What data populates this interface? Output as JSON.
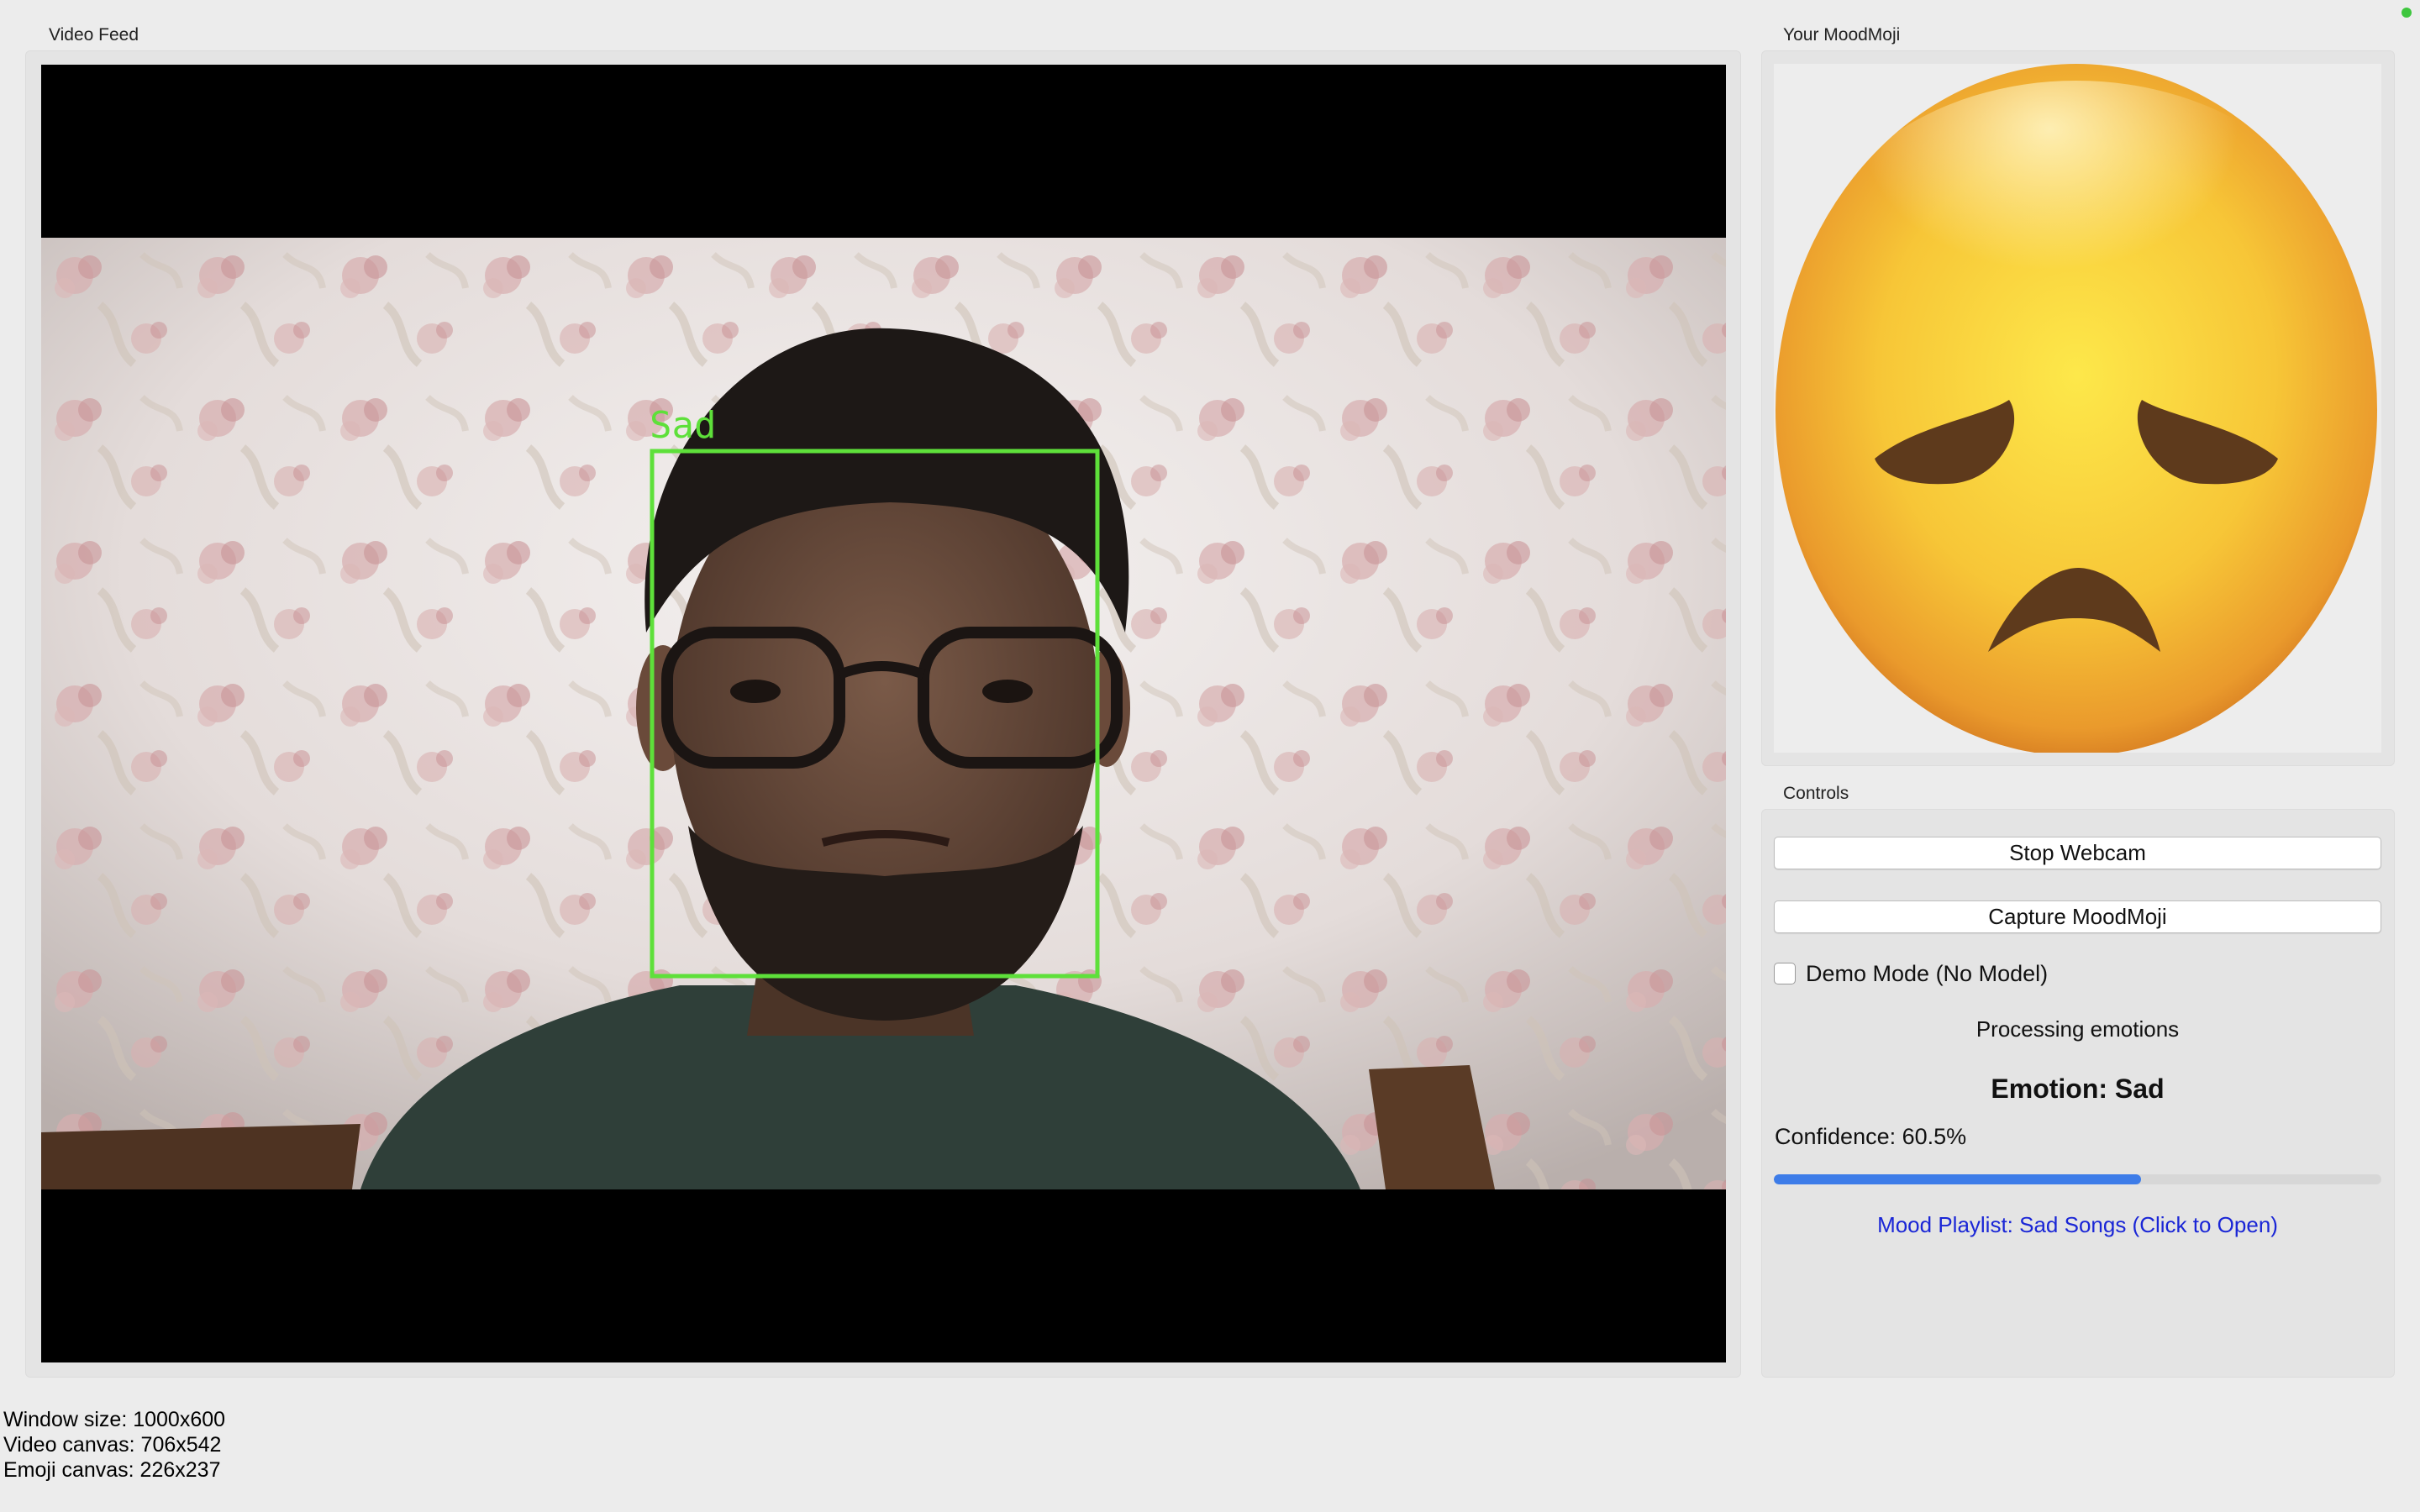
{
  "video": {
    "group_title": "Video Feed",
    "detection_label": "Sad"
  },
  "emoji": {
    "group_title": "Your MoodMoji",
    "emoji_icon": "sad-face-emoji"
  },
  "controls": {
    "group_title": "Controls",
    "stop_button": "Stop Webcam",
    "capture_button": "Capture MoodMoji",
    "demo_mode_label": "Demo Mode (No Model)",
    "demo_mode_checked": false,
    "processing_status": "Processing emotions",
    "emotion": "Emotion: Sad",
    "confidence": "Confidence: 60.5%",
    "confidence_value": 0.605,
    "playlist_link": "Mood Playlist: Sad Songs (Click to Open)"
  },
  "debug": {
    "window_size": "Window size: 1000x600",
    "video_canvas": "Video canvas: 706x542",
    "emoji_canvas": "Emoji canvas: 226x237"
  },
  "colors": {
    "detection_box": "#5ee03a",
    "progress_fill": "#3d7ce8",
    "link": "#1a26d6",
    "status_dot": "#3ec63e"
  }
}
